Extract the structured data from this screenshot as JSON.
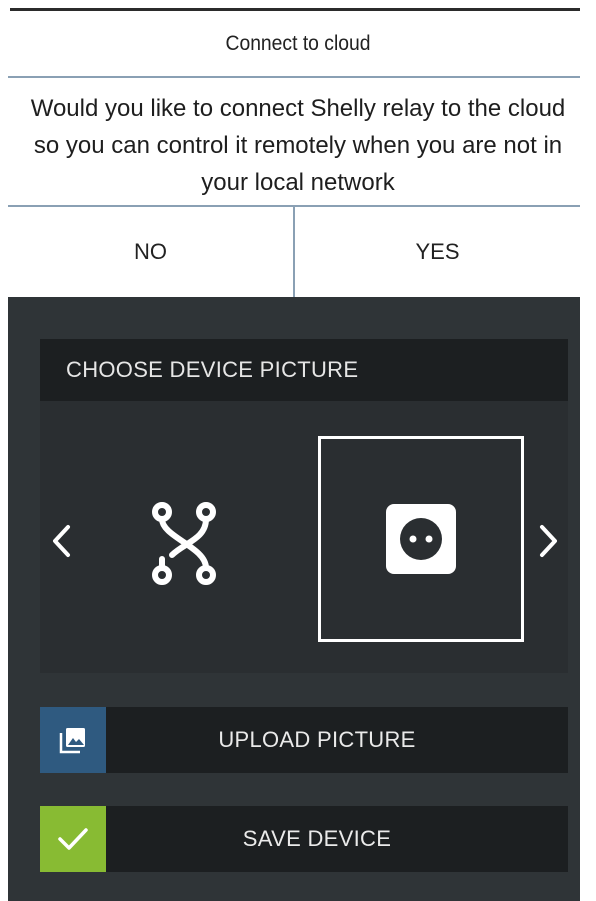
{
  "dialog": {
    "title": "Connect to cloud",
    "message": "Would you like to connect Shelly relay to the cloud so you can control it remotely when you are not in your local network",
    "no_label": "NO",
    "yes_label": "YES"
  },
  "picker": {
    "header": "CHOOSE DEVICE PICTURE",
    "options": [
      {
        "icon": "relay-icon",
        "selected": false
      },
      {
        "icon": "socket-icon",
        "selected": true
      }
    ]
  },
  "actions": {
    "upload_label": "UPLOAD PICTURE",
    "save_label": "SAVE DEVICE"
  },
  "colors": {
    "panel_bg": "#2f3437",
    "bar_bg": "#1c1f21",
    "upload_accent": "#2f5a80",
    "save_accent": "#88bb33",
    "divider": "#8aa0b4"
  }
}
